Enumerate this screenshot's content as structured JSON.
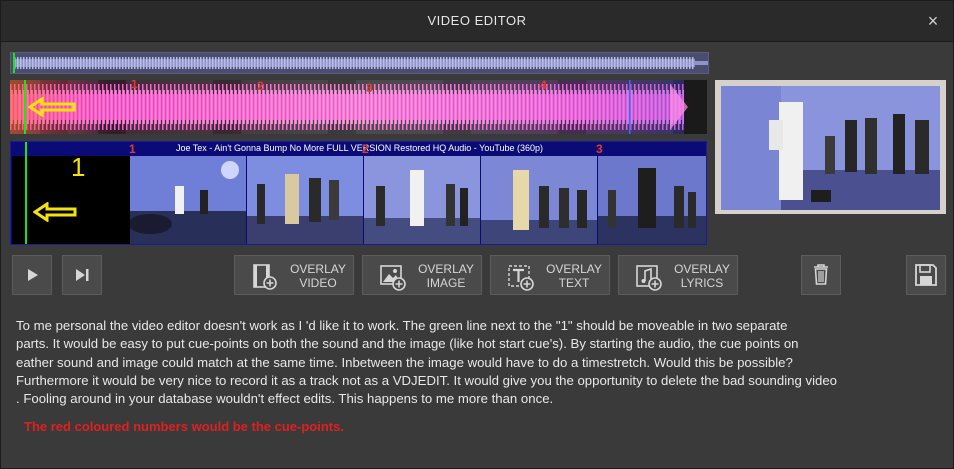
{
  "window": {
    "title": "VIDEO EDITOR",
    "close_glyph": "×"
  },
  "track": {
    "cue_labels_wave": [
      "1",
      "2",
      "3",
      "4"
    ],
    "cue_labels_strip": [
      "1",
      "2",
      "3"
    ],
    "strip_marker": "1",
    "video_title": "Joe Tex - Ain't Gonna Bump No More FULL VERSION Restored HQ Audio - YouTube (360p)"
  },
  "toolbar": {
    "play_icon": "play-icon",
    "next_icon": "skip-next-icon",
    "overlay_video": [
      "OVERLAY",
      "VIDEO"
    ],
    "overlay_image": [
      "OVERLAY",
      "IMAGE"
    ],
    "overlay_text": [
      "OVERLAY",
      "TEXT"
    ],
    "overlay_lyrics": [
      "OVERLAY",
      "LYRICS"
    ],
    "delete_icon": "trash-icon",
    "save_icon": "save-icon"
  },
  "description": {
    "lines": [
      "To me personal the video editor doesn't work as I 'd like it to work. The green line next to the \"1\" should be moveable in two separate",
      "parts. It would be easy to put cue-points on both the sound and the image (like hot start cue's). By starting the audio, the cue points on",
      "eather sound and image could match at the same time. Inbetween the image would have to do a timestretch. Would this be possible?",
      "Furthermore it would be very nice to record it as a track not as a VDJEDIT. It would give you the opportunity to delete the bad sounding video",
      ". Fooling around in your database wouldn't effect edits. This happens to me more than once."
    ],
    "note": "The red coloured numbers would be the cue-points."
  },
  "colors": {
    "cue_red": "#e23a2a",
    "arrow_yellow": "#f5e20a",
    "green_line": "#19e619",
    "strip_blue": "#0b0b78"
  }
}
